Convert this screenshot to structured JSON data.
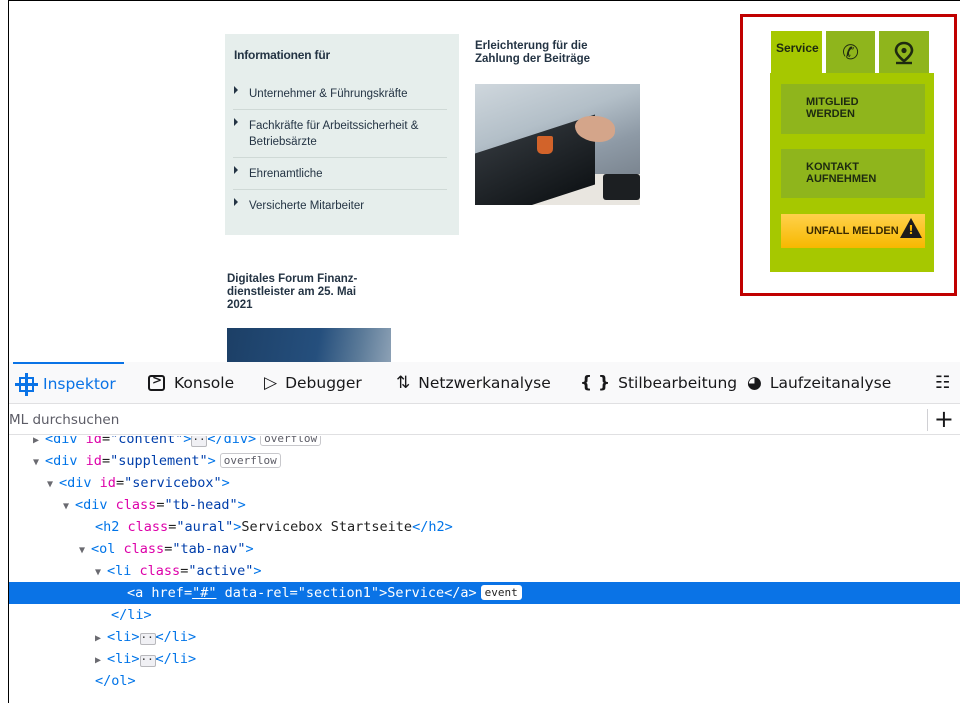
{
  "page": {
    "info_panel": {
      "title": "Informationen für",
      "items": [
        "Unternehmer & Führungskräfte",
        "Fachkräfte für Arbeitssicherheit & Betriebsärzte",
        "Ehrenamtliche",
        "Versicherte Mitarbeiter"
      ]
    },
    "promo": {
      "title_line1": "Erleichterung für die",
      "title_line2": "Zahlung der Beiträge"
    },
    "forum": {
      "title_line1": "Digitales Forum Finanz-",
      "title_line2": "dienstleister am 25. Mai",
      "title_line3": "2021"
    },
    "servicebox": {
      "tabs": {
        "service": "Service",
        "phone_icon": "phone-icon",
        "location_icon": "map-pin-icon"
      },
      "buttons": {
        "member_line1": "MITGLIED",
        "member_line2": "WERDEN",
        "contact_line1": "KONTAKT",
        "contact_line2": "AUFNEHMEN",
        "accident": "UNFALL MELDEN"
      },
      "colors": {
        "green": "#a6c800",
        "highlight": "#c00000",
        "warning": "#f7b800"
      }
    }
  },
  "devtools": {
    "tabs": {
      "inspector": "Inspektor",
      "console": "Konsole",
      "debugger": "Debugger",
      "network": "Netzwerkanalyse",
      "style": "Stilbearbeitung",
      "performance": "Laufzeitanalyse"
    },
    "search": {
      "placeholder": "ML durchsuchen"
    },
    "tree": {
      "r0": {
        "tag": "div",
        "attr": "id",
        "val": "\"content\"",
        "badge": "overflow"
      },
      "r1": {
        "tag": "div",
        "attr": "id",
        "val": "\"supplement\"",
        "badge": "overflow"
      },
      "r2": {
        "tag": "div",
        "attr": "id",
        "val": "\"servicebox\""
      },
      "r3": {
        "tag": "div",
        "attr": "class",
        "val": "\"tb-head\""
      },
      "r4": {
        "tag": "h2",
        "attr": "class",
        "val": "\"aural\"",
        "text": "Servicebox Startseite",
        "close": "</h2>"
      },
      "r5": {
        "tag": "ol",
        "attr": "class",
        "val": "\"tab-nav\""
      },
      "r6": {
        "tag": "li",
        "attr": "class",
        "val": "\"active\""
      },
      "r7": {
        "tag": "a",
        "attr1": "href",
        "val1": "\"#\"",
        "attr2": "data-rel",
        "val2": "\"section1\"",
        "text": "Service",
        "close": "</a>",
        "badge": "event"
      },
      "r8": {
        "close": "</li>"
      },
      "r9": {
        "tag": "li",
        "close": "</li>"
      },
      "r10": {
        "tag": "li",
        "close": "</li>"
      },
      "r11": {
        "close": "</ol>"
      }
    },
    "colors": {
      "accent": "#0a73e6"
    }
  }
}
